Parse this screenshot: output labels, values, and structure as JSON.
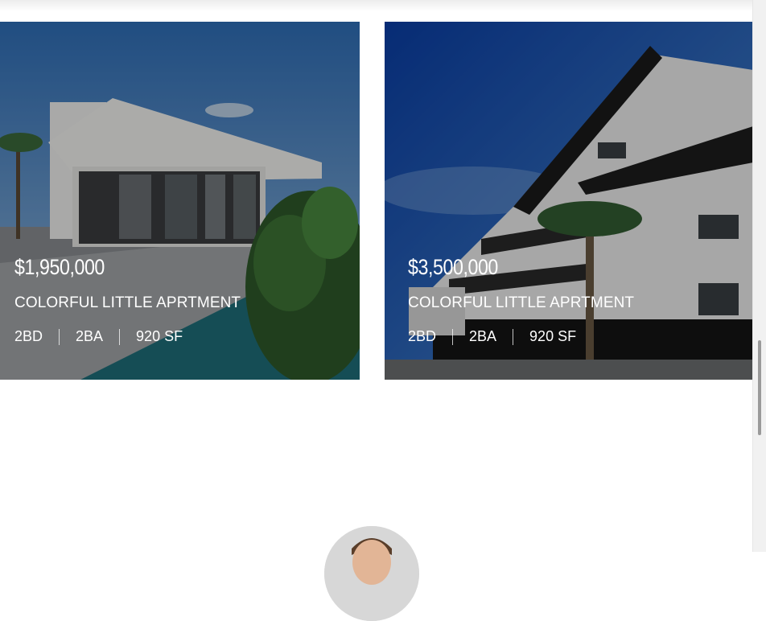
{
  "listings": [
    {
      "price": "$1,950,000",
      "title": "COLORFUL LITTLE APRTMENT",
      "beds": "2BD",
      "baths": "2BA",
      "area": "920 SF"
    },
    {
      "price": "$3,500,000",
      "title": "COLORFUL LITTLE APRTMENT",
      "beds": "2BD",
      "baths": "2BA",
      "area": "920 SF"
    }
  ]
}
